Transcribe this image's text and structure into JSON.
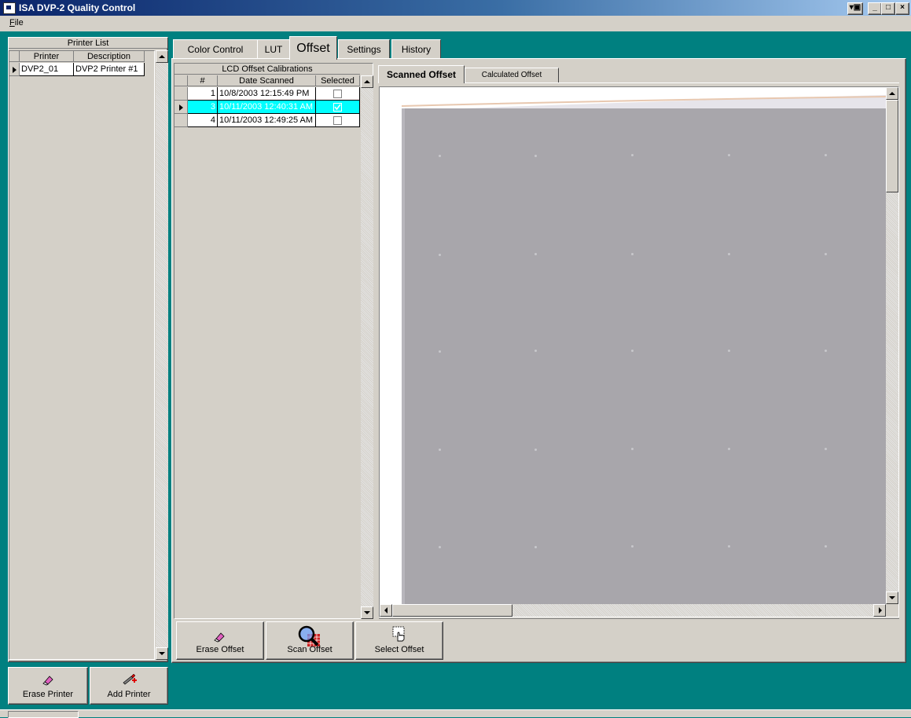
{
  "window": {
    "title": "ISA DVP-2 Quality Control",
    "btn_restore": "▾▣",
    "btn_min": "_",
    "btn_max": "□",
    "btn_close": "×"
  },
  "menu": {
    "file_accel": "F",
    "file_rest": "ile"
  },
  "printer_list": {
    "title": "Printer List",
    "columns": [
      "Printer",
      "Description"
    ],
    "rows": [
      {
        "printer": "DVP2_01",
        "description": "DVP2 Printer #1"
      }
    ]
  },
  "main_tabs": [
    {
      "label": "Color Control"
    },
    {
      "label": "LUT"
    },
    {
      "label": "Offset",
      "active": true
    },
    {
      "label": "Settings"
    },
    {
      "label": "History"
    }
  ],
  "calibrations": {
    "title": "LCD Offset Calibrations",
    "columns": [
      "#",
      "Date Scanned",
      "Selected"
    ],
    "rows": [
      {
        "num": "1",
        "date": "10/8/2003 12:15:49 PM",
        "selected": false
      },
      {
        "num": "3",
        "date": "10/11/2003 12:40:31 AM",
        "selected": true
      },
      {
        "num": "4",
        "date": "10/11/2003 12:49:25 AM",
        "selected": false
      }
    ],
    "current_row": 1,
    "highlight_color": "#00ffff"
  },
  "view_tabs": [
    {
      "label": "Scanned Offset",
      "active": true
    },
    {
      "label": "Calculated Offset"
    }
  ],
  "offset_buttons": [
    {
      "label": "Erase Offset",
      "icon": "eraser-icon"
    },
    {
      "label": "Scan Offset",
      "icon": "magnifier-grid-icon"
    },
    {
      "label": "Select Offset",
      "icon": "hand-pointer-icon"
    }
  ],
  "printer_buttons": [
    {
      "label": "Erase Printer",
      "icon": "eraser-icon"
    },
    {
      "label": "Add Printer",
      "icon": "pencil-plus-icon"
    }
  ],
  "colors": {
    "teal": "#008080",
    "face": "#d4d0c8",
    "scan_gray": "#a8a6ab"
  }
}
